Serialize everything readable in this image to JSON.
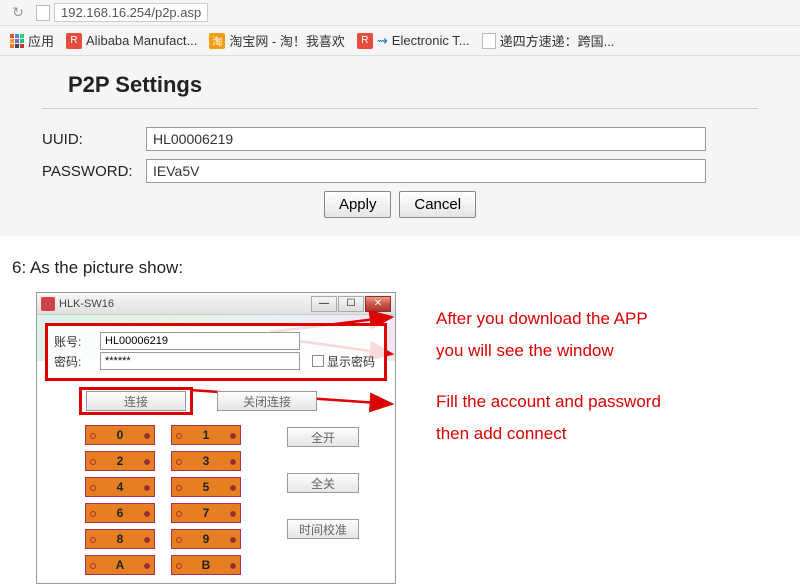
{
  "browser": {
    "url": "192.168.16.254/p2p.asp",
    "apps_label": "应用",
    "bookmarks": [
      {
        "label": "Alibaba Manufact..."
      },
      {
        "label": "淘宝网 - 淘！我喜欢"
      },
      {
        "label": "Electronic T..."
      },
      {
        "label": "递四方速递：跨国..."
      }
    ]
  },
  "settings": {
    "title": "P2P Settings",
    "uuid_label": "UUID:",
    "uuid_value": "HL00006219",
    "pwd_label": "PASSWORD:",
    "pwd_value": "IEVa5V",
    "apply": "Apply",
    "cancel": "Cancel"
  },
  "step_text": "6: As the picture show:",
  "app": {
    "title": "HLK-SW16",
    "acct_label": "账号:",
    "acct_value": "HL00006219",
    "pwd_label": "密码:",
    "pwd_value": "******",
    "show_pwd": "显示密码",
    "connect": "连接",
    "disconnect": "关闭连接",
    "all_on": "全开",
    "all_off": "全关",
    "time_cal": "时间校准",
    "buttons_left": [
      "0",
      "2",
      "4",
      "6",
      "8",
      "A"
    ],
    "buttons_right": [
      "1",
      "3",
      "5",
      "7",
      "9",
      "B"
    ]
  },
  "annotations": {
    "a1_l1": "After you download the APP",
    "a1_l2": "you will see the window",
    "a2_l1": "Fill the account and password",
    "a2_l2": "then add connect"
  }
}
